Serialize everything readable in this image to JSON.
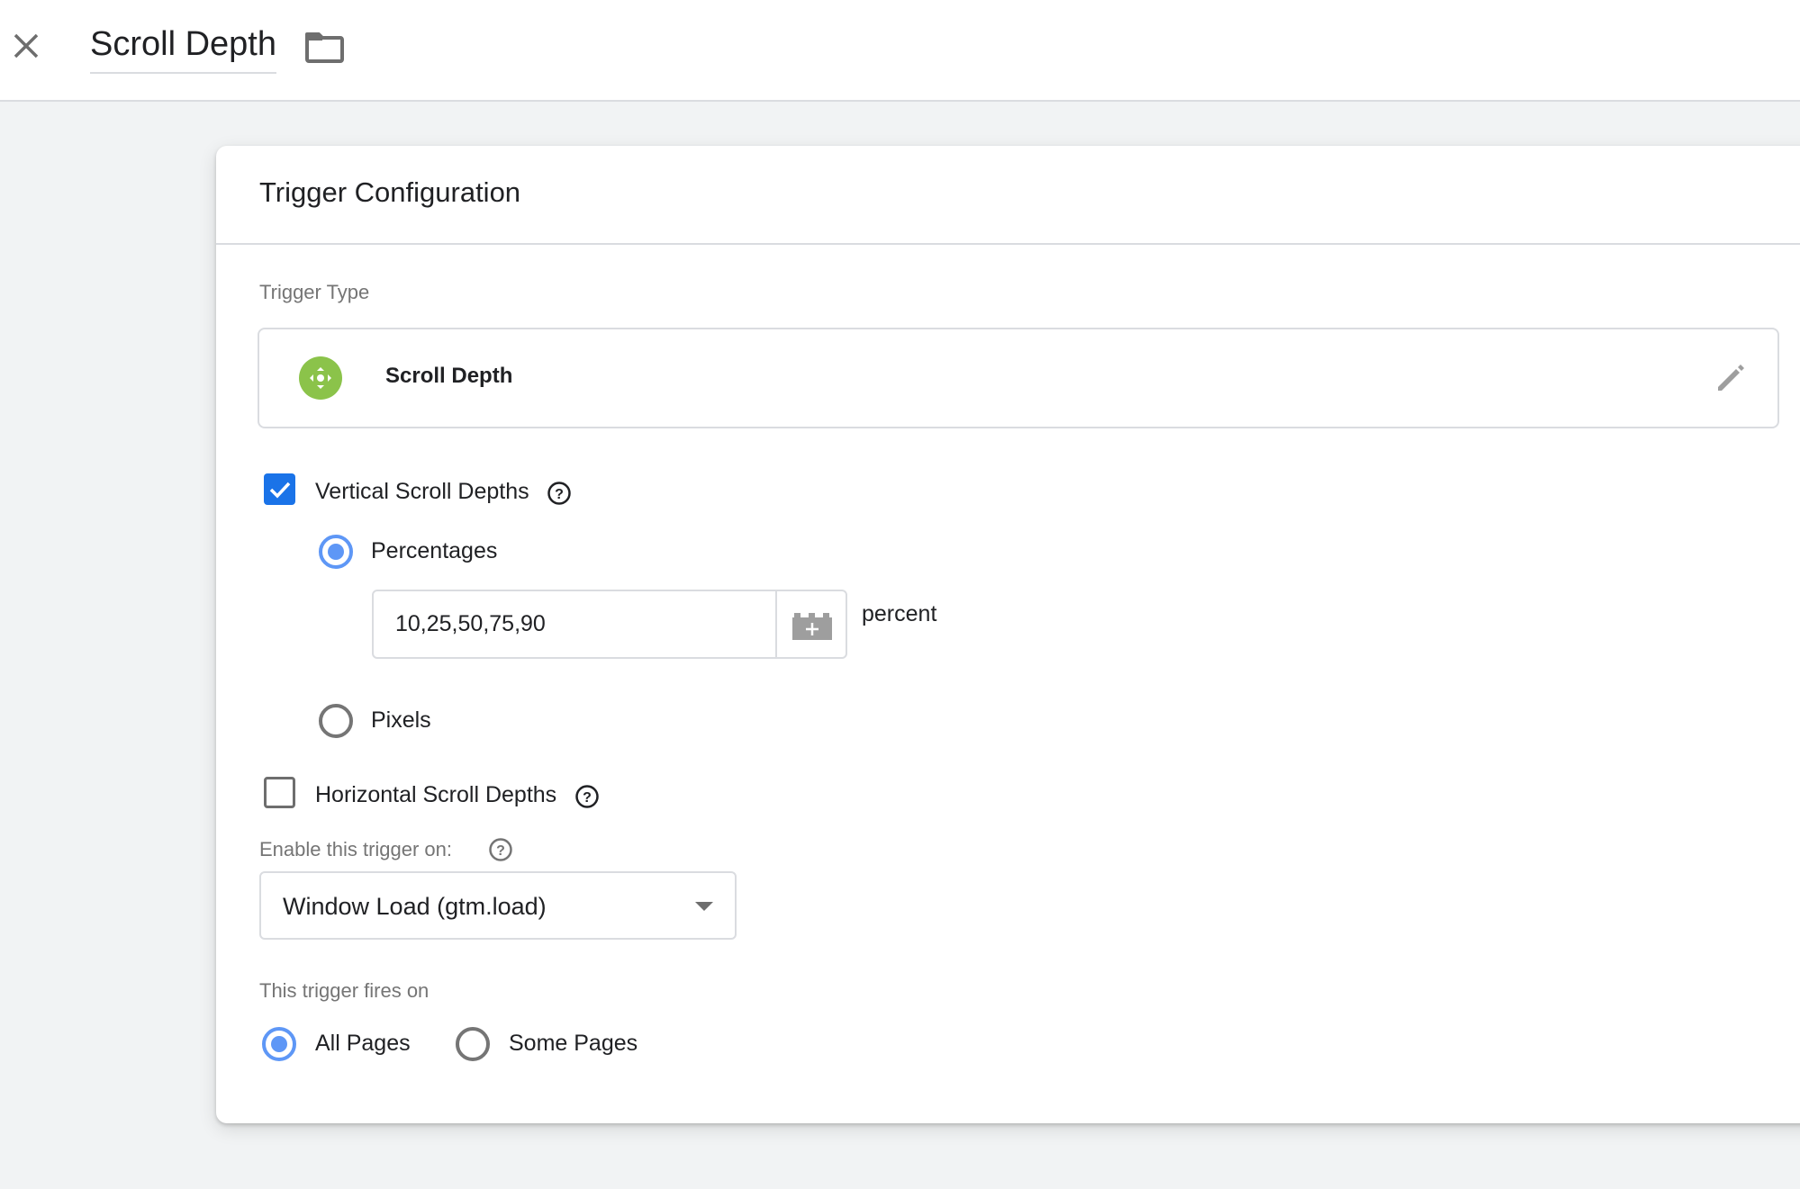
{
  "topbar": {
    "title": "Scroll Depth",
    "close_icon": "close-icon",
    "folder_icon": "folder-icon"
  },
  "card": {
    "title": "Trigger Configuration",
    "trigger_type_label": "Trigger Type",
    "trigger_type": {
      "name": "Scroll Depth",
      "icon": "scroll-depth-icon",
      "icon_color": "#8bc34a",
      "edit_icon": "pencil-icon"
    },
    "vertical": {
      "label": "Vertical Scroll Depths",
      "checked": true,
      "options": [
        {
          "label": "Percentages",
          "selected": true
        },
        {
          "label": "Pixels",
          "selected": false
        }
      ],
      "percent_input": {
        "value": "10,25,50,75,90"
      },
      "unit_label": "percent"
    },
    "horizontal": {
      "label": "Horizontal Scroll Depths",
      "checked": false
    },
    "enable_on": {
      "label": "Enable this trigger on:",
      "selected": "Window Load (gtm.load)"
    },
    "fires_on": {
      "label": "This trigger fires on",
      "options": [
        {
          "label": "All Pages",
          "selected": true
        },
        {
          "label": "Some Pages",
          "selected": false
        }
      ]
    }
  },
  "colors": {
    "accent": "#1a73e8",
    "radio_selected": "#5e97f6",
    "background": "#f1f3f4"
  }
}
